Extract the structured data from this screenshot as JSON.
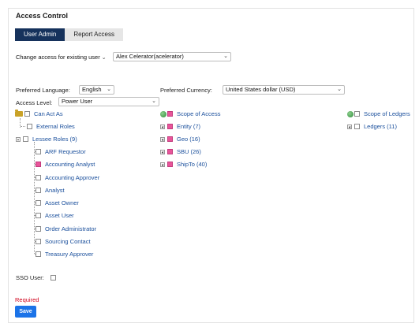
{
  "title": "Access Control",
  "tabs": [
    {
      "label": "User Admin",
      "active": true
    },
    {
      "label": "Report Access",
      "active": false
    }
  ],
  "change_access": {
    "value": "Change access for existing user"
  },
  "user_select": {
    "value": "Alex Celerator(acelerator)"
  },
  "preferred_language": {
    "label": "Preferred Language:",
    "value": "English"
  },
  "preferred_currency": {
    "label": "Preferred Currency:",
    "value": "United States dollar (USD)"
  },
  "access_level": {
    "label": "Access Level:",
    "value": "Power User"
  },
  "roles": {
    "can_act_as": "Can Act As",
    "external_roles": "External Roles",
    "lessee_roles": "Lessee Roles (9)",
    "items": [
      {
        "label": "ARF Requestor",
        "checked": false
      },
      {
        "label": "Accounting Analyst",
        "checked": true
      },
      {
        "label": "Accounting Approver",
        "checked": false
      },
      {
        "label": "Analyst",
        "checked": false
      },
      {
        "label": "Asset Owner",
        "checked": false
      },
      {
        "label": "Asset User",
        "checked": false
      },
      {
        "label": "Order Administrator",
        "checked": false
      },
      {
        "label": "Sourcing Contact",
        "checked": false
      },
      {
        "label": "Treasury Approver",
        "checked": false
      }
    ]
  },
  "scope_of_access": {
    "label": "Scope of Access",
    "items": [
      {
        "label": "Entity (7)",
        "checked": true
      },
      {
        "label": "Geo (16)",
        "checked": true
      },
      {
        "label": "SBU (26)",
        "checked": true
      },
      {
        "label": "ShipTo (40)",
        "checked": true
      }
    ]
  },
  "scope_of_ledgers": {
    "label": "Scope of Ledgers",
    "items": [
      {
        "label": "Ledgers (11)",
        "checked": false
      }
    ]
  },
  "sso_user": {
    "label": "SSO User:"
  },
  "required_text": "Required",
  "save_label": "Save",
  "colors": {
    "accent": "#16325c",
    "link": "#1a4f9c",
    "checked": "#e8559a",
    "save": "#1b73e8",
    "required": "#d0021b"
  }
}
